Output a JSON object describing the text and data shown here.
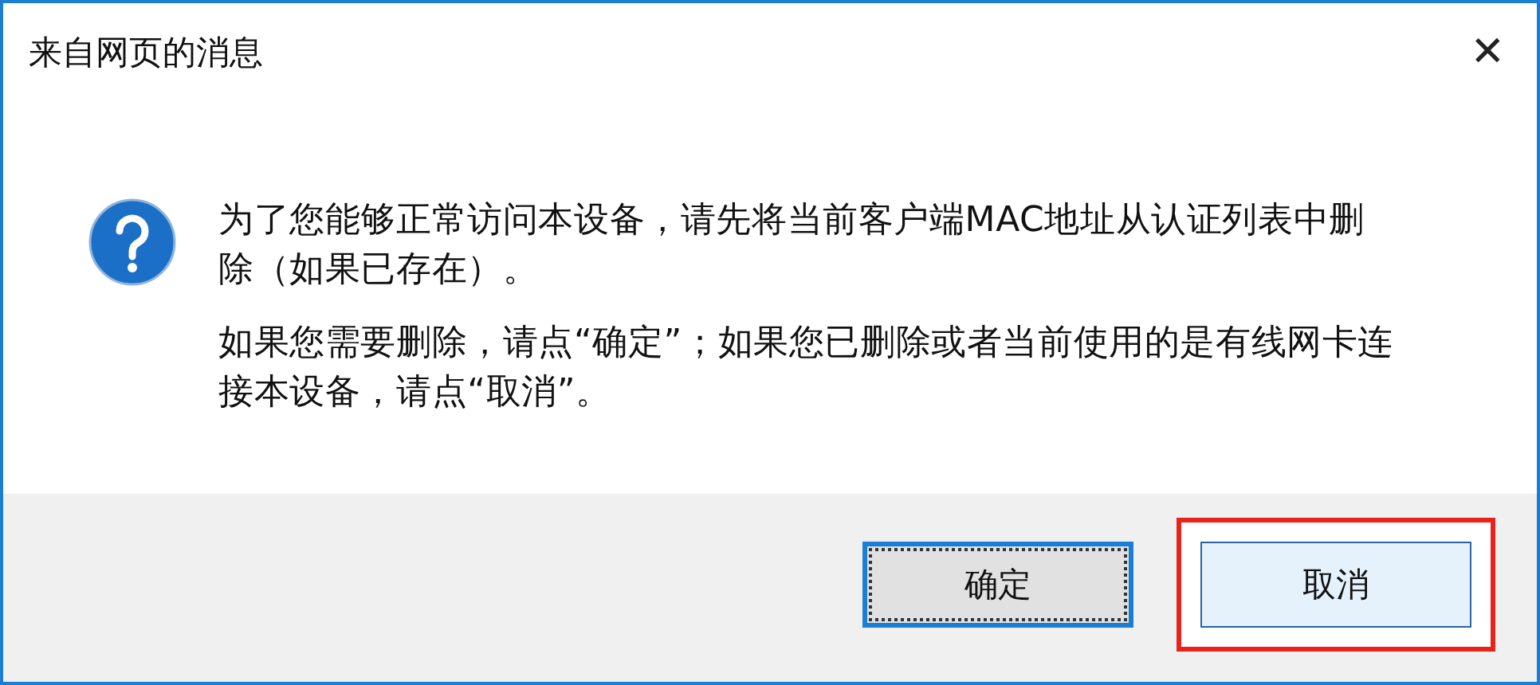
{
  "window": {
    "title": "来自网页的消息",
    "close": "✕"
  },
  "message": {
    "paragraphs": [
      "为了您能够正常访问本设备，请先将当前客户端MAC地址从认证列表中删除（如果已存在）。",
      "如果您需要删除，请点“确定”；如果您已删除或者当前使用的是有线网卡连接本设备，请点“取消”。"
    ]
  },
  "buttons": [
    {
      "label": "确定",
      "focused": true,
      "highlighted": false
    },
    {
      "label": "取消",
      "focused": false,
      "highlighted": true
    }
  ]
}
